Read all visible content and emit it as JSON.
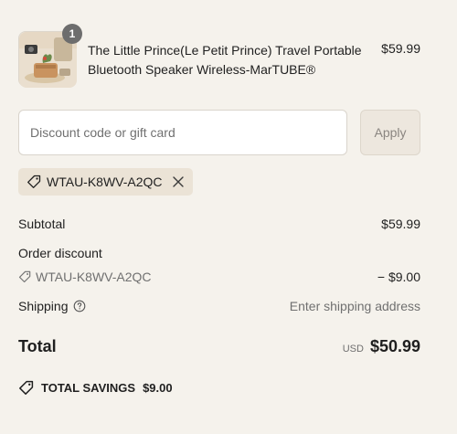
{
  "cart": {
    "item": {
      "quantity": "1",
      "title": "The Little Prince(Le Petit Prince) Travel Portable Bluetooth Speaker Wireless-MarTUBE®",
      "price": "$59.99"
    }
  },
  "discount": {
    "placeholder": "Discount code or gift card",
    "value": "",
    "apply_label": "Apply",
    "applied_code": "WTAU-K8WV-A2QC"
  },
  "summary": {
    "subtotal_label": "Subtotal",
    "subtotal_value": "$59.99",
    "order_discount_label": "Order discount",
    "discount_code": "WTAU-K8WV-A2QC",
    "discount_value": "− $9.00",
    "shipping_label": "Shipping",
    "shipping_value": "Enter shipping address",
    "total_label": "Total",
    "currency": "USD",
    "total_value": "$50.99",
    "savings_label": "TOTAL SAVINGS",
    "savings_value": "$9.00"
  },
  "icons": {
    "tag": "tag-icon",
    "remove": "close-icon",
    "help": "question-circle-icon"
  },
  "colors": {
    "background": "#f5f2ec",
    "tag_background": "#ebe3d6",
    "muted_text": "#707070",
    "badge": "#6d6d6d"
  }
}
